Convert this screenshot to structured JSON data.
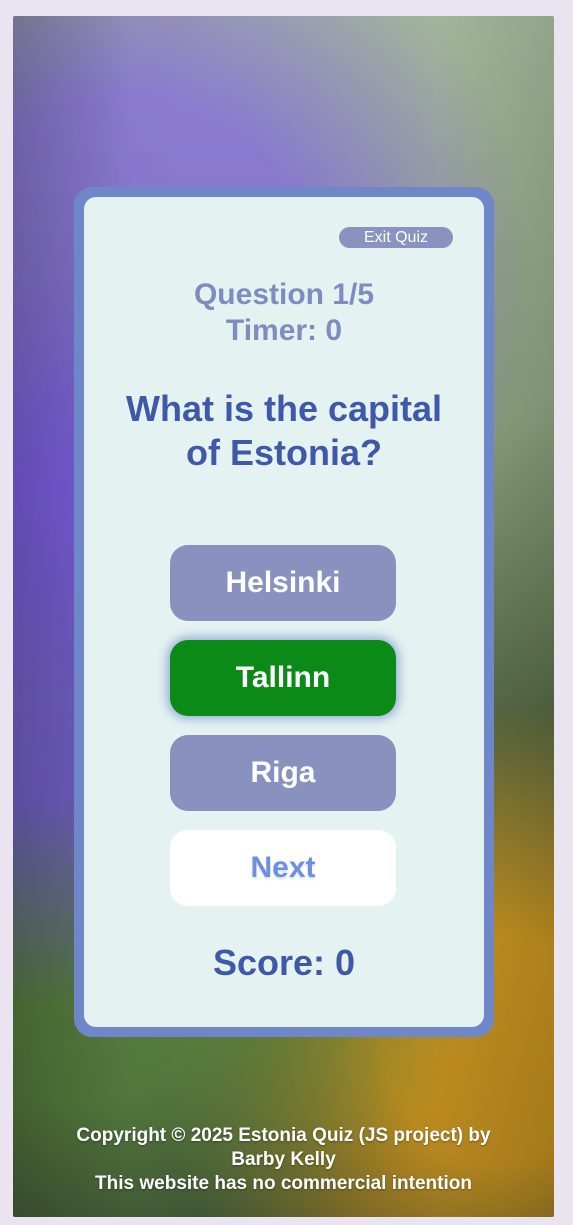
{
  "quiz": {
    "exit_label": "Exit Quiz",
    "question_counter": "Question 1/5",
    "timer": "Timer: 0",
    "question_text": "What is the capital of Estonia?",
    "answers": [
      {
        "label": "Helsinki",
        "state": "default"
      },
      {
        "label": "Tallinn",
        "state": "correct"
      },
      {
        "label": "Riga",
        "state": "default"
      }
    ],
    "next_label": "Next",
    "score": "Score: 0"
  },
  "footer": {
    "line1": "Copyright © 2025 Estonia Quiz (JS project) by",
    "line2": "Barby Kelly",
    "line3": "This website has no commercial intention"
  },
  "colors": {
    "card_border": "#6f86c8",
    "card_bg": "#e4f3f1",
    "button_default": "#8992bf",
    "button_correct": "#0c8a17",
    "primary_text": "#3f58a8",
    "muted_text": "#7f8cbf"
  }
}
